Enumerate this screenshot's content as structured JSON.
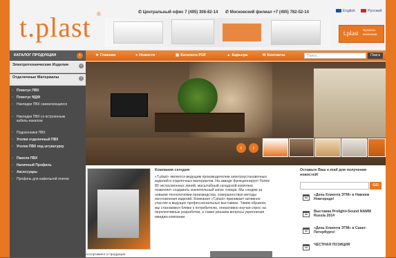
{
  "logo": {
    "text": "t.plast",
    "reg": "®"
  },
  "header": {
    "phone_central": "Центральный офис 7 (495) 308-82-14",
    "phone_moscow": "Московский филиал +7 (495) 782-52-14",
    "lang_english": "English",
    "lang_russian": "Русский",
    "promo_logo": "t.plast",
    "promo_text": "Проекты компании"
  },
  "nav": {
    "catalog": "КАТАЛОГ ПРОДУКЦИИ",
    "items": [
      "Главная",
      "Новости",
      "Каталоги PDF",
      "Карьера",
      "Контакты"
    ],
    "search_placeholder": "Поиск...",
    "search_button": "Поиск"
  },
  "sidebar": {
    "head1": "Электротехнические Изделия",
    "head2": "Отделочные Материалы",
    "items": [
      {
        "label": "Плинтус ПВХ",
        "bold": true
      },
      {
        "label": "Плинтус МДФ",
        "bold": true
      },
      {
        "label": "Накладки ПВХ самоклеющиеся",
        "bold": false
      },
      {
        "label": "Накладки ПВХ со встроенным кабель-каналом",
        "bold": false
      },
      {
        "label": "Подоконники ПВХ",
        "bold": false
      },
      {
        "label": "Уголки отделочный ПВХ",
        "bold": true
      },
      {
        "label": "Уголок ПВХ под штукатурку",
        "bold": true
      },
      {
        "label": "Панели ПВХ",
        "bold": true
      },
      {
        "label": "Наличный Профиль",
        "bold": true
      },
      {
        "label": "Аксессуары",
        "bold": true
      },
      {
        "label": "Профиль для кафельной плитки",
        "bold": false
      }
    ]
  },
  "content": {
    "title": "Компания сегодня",
    "body": "«T.plast» является ведущим производителем электроустановочных изделий и отделочных материалов. На заводе функционирует более 80 экструзионных линий, масштабный складской комплекс позволяет создавать значительный запас товара. Мы следим за новыми технологиями производства, совершенствуя методы изготовления изделий. Компания «T.plast» принимает активное участие в ведущих профессиональных выставках. Таким образом, мы становимся ближе к потребителю, оперативно изучая спрос на перспективные разработки, а также решаем вопросы укрепления имиджа компании.",
    "bottom": "Ассортимент и продукция"
  },
  "subscribe": {
    "title": "Оставьте Ваш e-mail для получения новостей!",
    "button": "GO"
  },
  "news": [
    "«День Клиента ЭТМ» в Нижнем Новгороде!",
    "Выставка Prolight+Sound NAMM Russia 2014",
    "«День Клиента ЭТМ» в Санкт-Петербурге!",
    "ЧЕСТНАЯ ПОЗИЦИЯ"
  ],
  "colors": {
    "accent": "#e87722",
    "sidebar": "#4b4b4b"
  }
}
